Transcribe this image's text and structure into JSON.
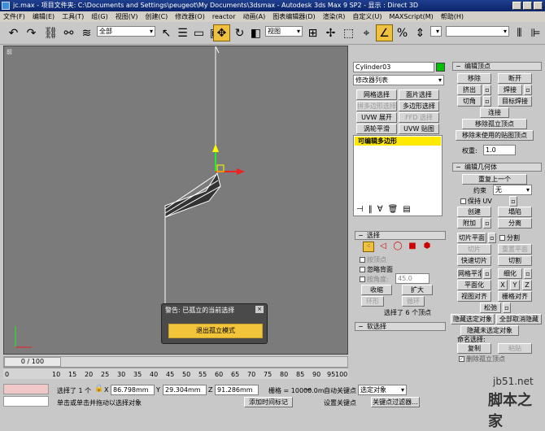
{
  "title": "jc.max   - 项目文件夹: C:\\Documents and Settings\\peugeot\\My Documents\\3dsmax   - Autodesk 3ds Max 9 SP2   - 显示 : Direct 3D",
  "menu": [
    "文件(F)",
    "编辑(E)",
    "工具(T)",
    "组(G)",
    "视图(V)",
    "创建(C)",
    "修改器(O)",
    "reactor",
    "动画(A)",
    "图表编辑器(D)",
    "渲染(R)",
    "自定义(U)",
    "MAXScript(M)",
    "帮助(H)"
  ],
  "toolbar": {
    "selection_filter": "全部",
    "coord_system": "视图"
  },
  "viewport": {
    "label": "前"
  },
  "dialog": {
    "title": "警告: 已孤立的当前选择",
    "button": "退出孤立模式"
  },
  "command_panel": {
    "object_name": "Cylinder03",
    "modifier_list": "修改器列表",
    "buttons": [
      [
        "网格选择",
        "面片选择"
      ],
      [
        "拼多边形选择",
        "多边形选择"
      ],
      [
        "UVW 展开",
        "FFD 选择"
      ],
      [
        "涡轮平滑",
        "UVW 贴图"
      ]
    ],
    "stack_item": "可编辑多边形",
    "selection_title": "选择",
    "by_vertex": "按顶点",
    "ignore_backfacing": "忽略背面",
    "by_angle": "按角度:",
    "angle_value": "45.0",
    "shrink": "收缩",
    "grow": "扩大",
    "ring": "环形",
    "loop": "循环",
    "selected_info": "选择了 6 个顶点",
    "soft_select": "软选择"
  },
  "right_panel": {
    "edit_vertices": "编辑顶点",
    "remove": "移除",
    "break": "断开",
    "extrude": "挤出",
    "weld": "焊接",
    "chamfer": "切角",
    "target_weld": "目标焊接",
    "connect": "连接",
    "remove_isolated": "移除孤立顶点",
    "remove_unused": "移除未使用的贴图顶点",
    "weight_label": "权重:",
    "weight_value": "1.0",
    "edit_geometry": "编辑几何体",
    "repeat_last": "重复上一个",
    "constraint_label": "约束",
    "constraint_value": "无",
    "preserve_uv": "保持 UV",
    "create": "创建",
    "collapse": "塌陷",
    "attach": "附加",
    "detach": "分离",
    "slice_plane": "切片平面",
    "split": "分割",
    "slice": "切片",
    "reset_plane": "重置平面",
    "quickslice": "快速切片",
    "cut": "切割",
    "meshsmooth": "网格平滑",
    "tessellate": "细化",
    "make_planar": "平面化",
    "x": "X",
    "y": "Y",
    "z": "Z",
    "view_align": "视图对齐",
    "grid_align": "栅格对齐",
    "relax": "松弛",
    "hide_selected": "隐藏选定对象",
    "unhide_all": "全部取消隐藏",
    "hide_unselected": "隐藏未选定对象",
    "named_sel": "命名选择:",
    "copy": "复制",
    "paste": "粘贴",
    "delete_isolated": "删除孤立顶点"
  },
  "timeline": {
    "frame": "0 / 100",
    "ticks": [
      "0",
      "10",
      "15",
      "20",
      "25",
      "30",
      "35",
      "40",
      "45",
      "50",
      "55",
      "60",
      "65",
      "70",
      "75",
      "80",
      "85",
      "90",
      "95",
      "100"
    ]
  },
  "status": {
    "selected": "选择了 1 个",
    "x_label": "X",
    "x_value": "86.798mm",
    "y_label": "Y",
    "y_value": "29.304mm",
    "z_label": "Z",
    "z_value": "91.286mm",
    "grid": "栅格 = 10000.0m",
    "prompt": "单击或单击并拖动以选择对象",
    "add_time_tag": "添加时间标记",
    "auto_key": "自动关键点",
    "set_key": "设置关键点",
    "selected_obj": "选定对象",
    "key_filters": "关键点过滤器..."
  },
  "watermark": {
    "site": "jb51.net",
    "brand": "脚本之家"
  },
  "colors": {
    "viewport": "#7b7b7b",
    "highlight": "#ffe900",
    "dialog_button": "#f2c439",
    "title": "#0a246a"
  }
}
